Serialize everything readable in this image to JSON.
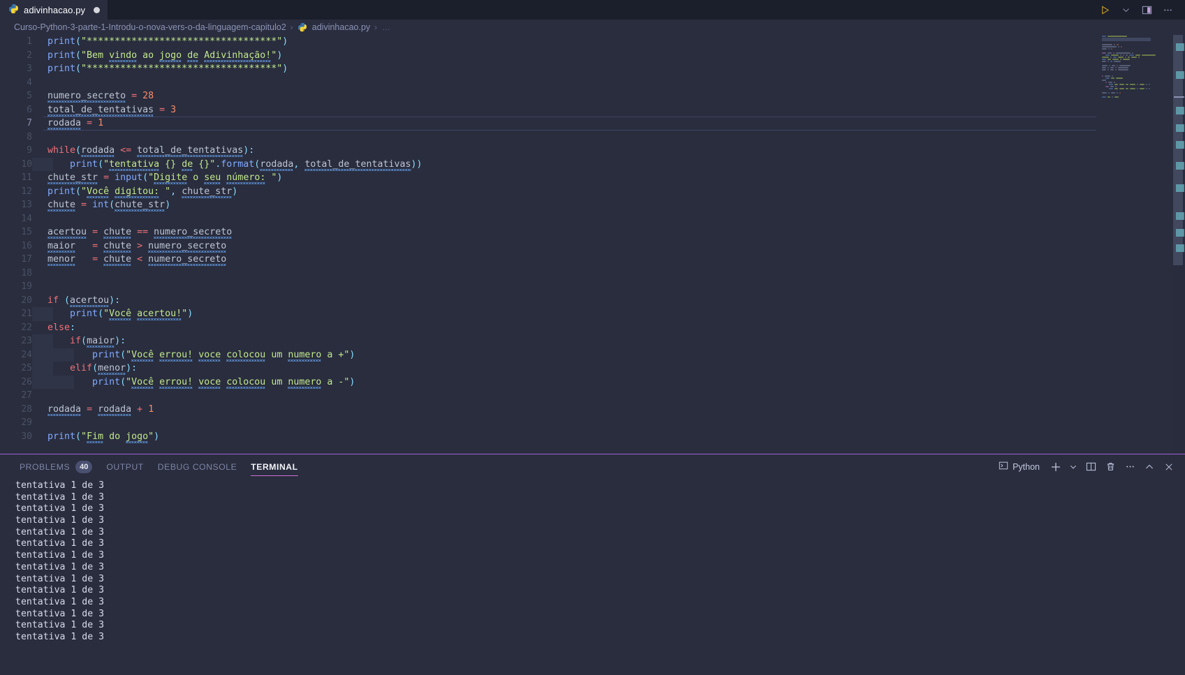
{
  "window": {
    "tab": {
      "label": "adivinhacao.py",
      "icon": "python-file-icon",
      "dirty": true
    },
    "actions": [
      {
        "name": "run-button",
        "icon": "play-icon"
      },
      {
        "name": "run-options-button",
        "icon": "chevron-down-icon"
      },
      {
        "name": "split-editor-button",
        "icon": "split-editor-icon"
      },
      {
        "name": "more-actions-button",
        "icon": "ellipsis-icon"
      }
    ]
  },
  "breadcrumbs": {
    "folder": "Curso-Python-3-parte-1-Introdu-o-nova-vers-o-da-linguagem-capitulo2",
    "separator": "›",
    "file": "adivinhacao.py",
    "overflow": "…"
  },
  "editor": {
    "language": "python",
    "current_line": 7,
    "lines": [
      {
        "n": 1,
        "text": "print(\"**********************************\")"
      },
      {
        "n": 2,
        "text": "print(\"Bem vindo ao jogo de Adivinhação!\")"
      },
      {
        "n": 3,
        "text": "print(\"**********************************\")"
      },
      {
        "n": 4,
        "text": ""
      },
      {
        "n": 5,
        "text": "numero_secreto = 28"
      },
      {
        "n": 6,
        "text": "total_de_tentativas = 3"
      },
      {
        "n": 7,
        "text": "rodada = 1"
      },
      {
        "n": 8,
        "text": ""
      },
      {
        "n": 9,
        "text": "while(rodada <= total_de_tentativas):"
      },
      {
        "n": 10,
        "text": "    print(\"tentativa {} de {}\".format(rodada, total_de_tentativas))"
      },
      {
        "n": 11,
        "text": "chute_str = input(\"Digite o seu número: \")"
      },
      {
        "n": 12,
        "text": "print(\"Você digitou: \", chute_str)"
      },
      {
        "n": 13,
        "text": "chute = int(chute_str)"
      },
      {
        "n": 14,
        "text": ""
      },
      {
        "n": 15,
        "text": "acertou = chute == numero_secreto"
      },
      {
        "n": 16,
        "text": "maior   = chute > numero_secreto"
      },
      {
        "n": 17,
        "text": "menor   = chute < numero_secreto"
      },
      {
        "n": 18,
        "text": ""
      },
      {
        "n": 19,
        "text": ""
      },
      {
        "n": 20,
        "text": "if (acertou):"
      },
      {
        "n": 21,
        "text": "    print(\"Você acertou!\")"
      },
      {
        "n": 22,
        "text": "else:"
      },
      {
        "n": 23,
        "text": "    if(maior):"
      },
      {
        "n": 24,
        "text": "        print(\"Você errou! voce colocou um numero a +\")"
      },
      {
        "n": 25,
        "text": "    elif(menor):"
      },
      {
        "n": 26,
        "text": "        print(\"Você errou! voce colocou um numero a -\")"
      },
      {
        "n": 27,
        "text": ""
      },
      {
        "n": 28,
        "text": "rodada = rodada + 1"
      },
      {
        "n": 29,
        "text": ""
      },
      {
        "n": 30,
        "text": "print(\"Fim do jogo\")"
      }
    ]
  },
  "panel": {
    "tabs": [
      {
        "label": "Problems",
        "badge": "40",
        "active": false
      },
      {
        "label": "Output",
        "badge": null,
        "active": false
      },
      {
        "label": "Debug Console",
        "badge": null,
        "active": false
      },
      {
        "label": "Terminal",
        "badge": null,
        "active": true
      }
    ],
    "terminal_select": {
      "label": "Python",
      "icon": "terminal-icon"
    },
    "actions": [
      {
        "name": "new-terminal-button",
        "icon": "plus-icon"
      },
      {
        "name": "terminal-profile-dropdown-button",
        "icon": "chevron-down-icon"
      },
      {
        "name": "split-terminal-button",
        "icon": "split-icon"
      },
      {
        "name": "kill-terminal-button",
        "icon": "trash-icon"
      },
      {
        "name": "panel-more-actions-button",
        "icon": "ellipsis-icon"
      },
      {
        "name": "maximize-panel-button",
        "icon": "chevron-up-icon"
      },
      {
        "name": "close-panel-button",
        "icon": "close-icon"
      }
    ],
    "terminal_output": [
      "tentativa 1 de 3",
      "tentativa 1 de 3",
      "tentativa 1 de 3",
      "tentativa 1 de 3",
      "tentativa 1 de 3",
      "tentativa 1 de 3",
      "tentativa 1 de 3",
      "tentativa 1 de 3",
      "tentativa 1 de 3",
      "tentativa 1 de 3",
      "tentativa 1 de 3",
      "tentativa 1 de 3",
      "tentativa 1 de 3",
      "tentativa 1 de 3"
    ]
  },
  "colors": {
    "background": "#292d3e",
    "tabbar_background": "#1b1e2b",
    "accent": "#a05fd4",
    "active_tab_underline": "#d06fd0",
    "string": "#c3e88d",
    "keyword": "#c792ea",
    "function": "#82aaff",
    "number": "#f78c6c",
    "operator": "#89ddff",
    "squiggle": "#6aa8f7",
    "overview_mark": "#6ab7c4"
  }
}
